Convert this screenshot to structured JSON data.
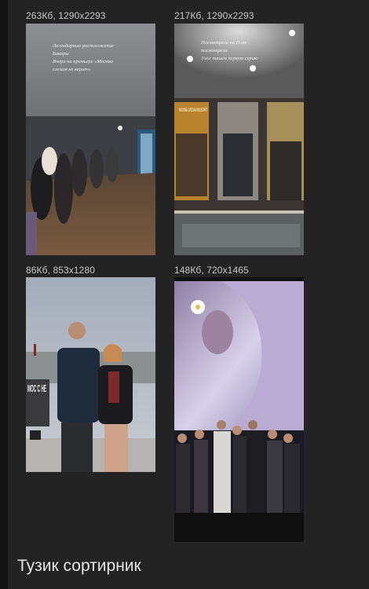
{
  "gallery": {
    "items": [
      {
        "size": "263Кб",
        "dims": "1290x2293",
        "meta": "263Кб, 1290x2293",
        "overlay_text": [
          "Легендарные расположение",
          "Бакоры",
          "Вчера на премьере «Москва",
          "слезам не верит»"
        ]
      },
      {
        "size": "217Кб",
        "dims": "1290x2293",
        "meta": "217Кб, 1290x2293",
        "overlay_text": [
          "Посмотрели на Н.ов",
          "посмотрели",
          "Уже пишем первую серию"
        ],
        "poster_text": "МОСКВА СЛЕЗАМ НЕ ВЕРИТ"
      },
      {
        "size": "86Кб",
        "dims": "853x1280",
        "meta": "86Кб, 853x1280",
        "sign_text": "МОС С НЕ"
      },
      {
        "size": "148Кб",
        "dims": "720x1465",
        "meta": "148Кб, 720x1465"
      }
    ]
  },
  "caption": "Тузик сортирник"
}
